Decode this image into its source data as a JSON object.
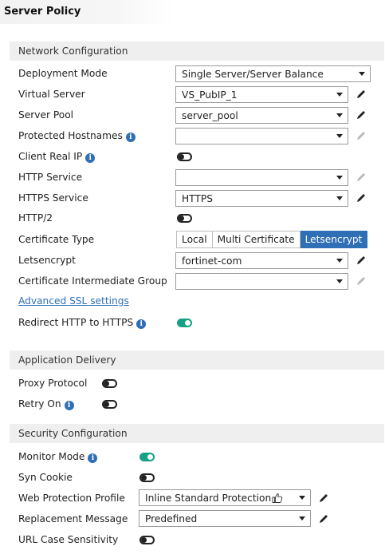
{
  "window": {
    "title": "Server Policy"
  },
  "sections": {
    "network": "Network Configuration",
    "delivery": "Application Delivery",
    "security": "Security Configuration"
  },
  "network": {
    "deployment_mode": {
      "label": "Deployment Mode",
      "value": "Single Server/Server Balance"
    },
    "virtual_server": {
      "label": "Virtual Server",
      "value": "VS_PubIP_1"
    },
    "server_pool": {
      "label": "Server Pool",
      "value": "server_pool"
    },
    "protected_hostnames": {
      "label": "Protected Hostnames",
      "value": ""
    },
    "client_real_ip": {
      "label": "Client Real IP",
      "enabled": false
    },
    "http_service": {
      "label": "HTTP Service",
      "value": ""
    },
    "https_service": {
      "label": "HTTPS Service",
      "value": "HTTPS"
    },
    "http2": {
      "label": "HTTP/2",
      "enabled": false
    },
    "certificate_type": {
      "label": "Certificate Type",
      "options": [
        "Local",
        "Multi Certificate",
        "Letsencrypt"
      ],
      "selected": "Letsencrypt"
    },
    "letsencrypt": {
      "label": "Letsencrypt",
      "value": "fortinet-com"
    },
    "cert_intermediate_group": {
      "label": "Certificate Intermediate Group",
      "value": ""
    },
    "advanced_ssl_link": "Advanced SSL settings",
    "redirect_http_https": {
      "label": "Redirect HTTP to HTTPS",
      "enabled": true
    }
  },
  "delivery": {
    "proxy_protocol": {
      "label": "Proxy Protocol",
      "enabled": false
    },
    "retry_on": {
      "label": "Retry On",
      "enabled": false
    }
  },
  "security": {
    "monitor_mode": {
      "label": "Monitor Mode",
      "enabled": true
    },
    "syn_cookie": {
      "label": "Syn Cookie",
      "enabled": false
    },
    "web_protection_profile": {
      "label": "Web Protection Profile",
      "value": "Inline Standard Protection"
    },
    "replacement_message": {
      "label": "Replacement Message",
      "value": "Predefined"
    },
    "url_case_sensitivity": {
      "label": "URL Case Sensitivity",
      "enabled": false
    }
  },
  "colors": {
    "accent": "#2f6fb6",
    "toggle_on": "#16a085",
    "section_bg": "#efefef"
  },
  "icons": [
    "info-icon",
    "pencil-icon",
    "thumbs-up-icon",
    "chevron-down-icon"
  ]
}
